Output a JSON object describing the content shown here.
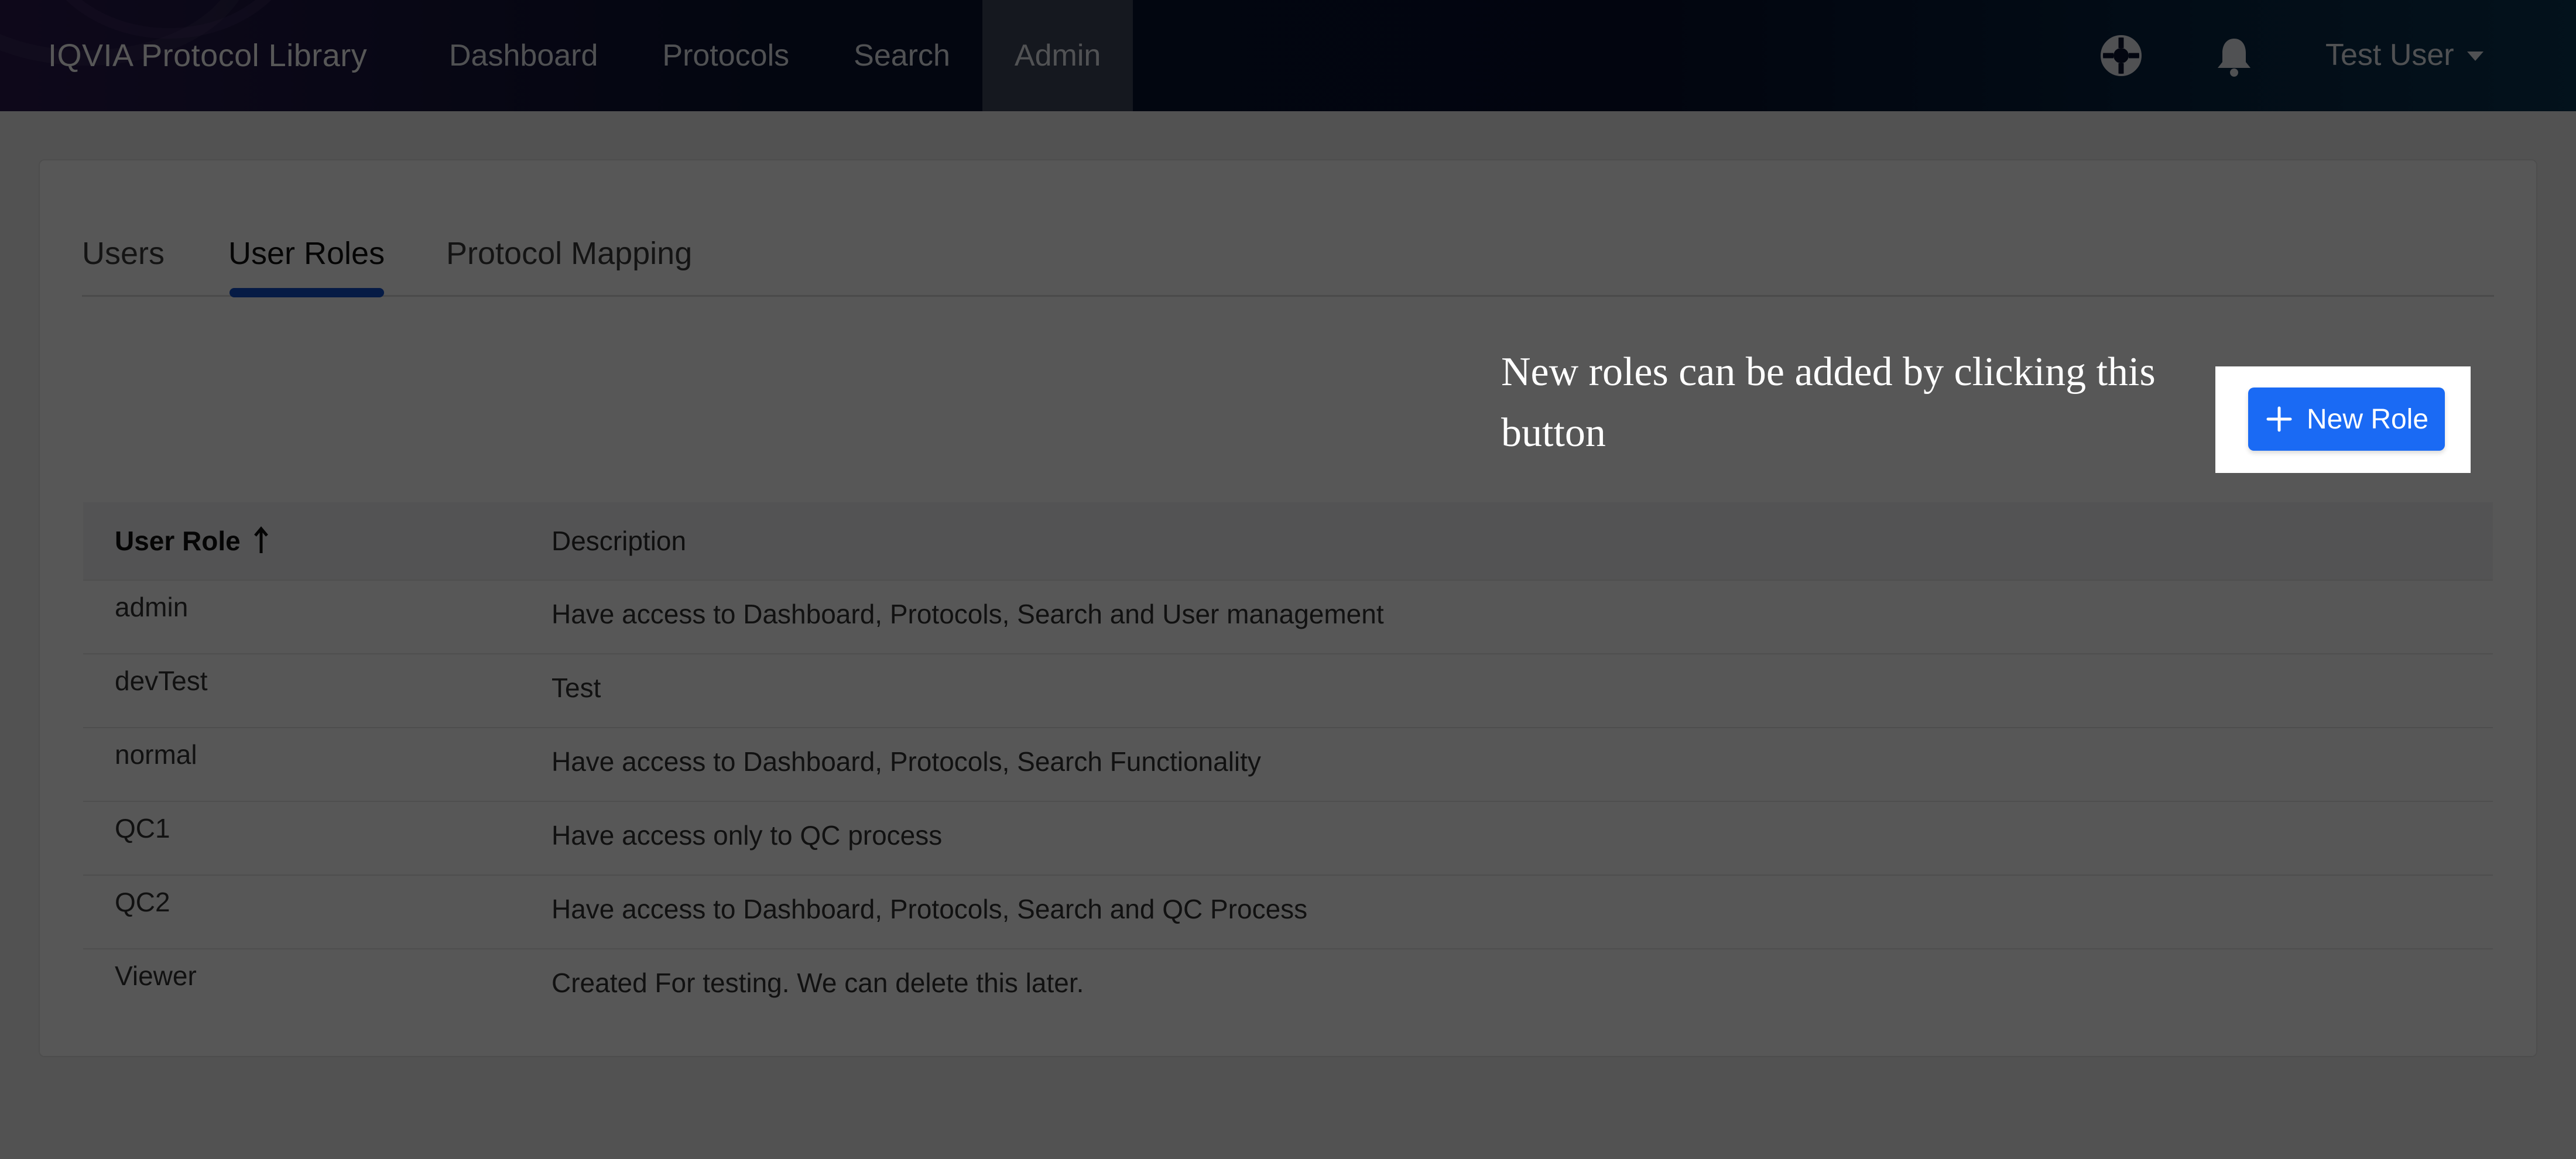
{
  "header": {
    "app_title": "IQVIA Protocol Library",
    "nav": [
      {
        "label": "Dashboard"
      },
      {
        "label": "Protocols"
      },
      {
        "label": "Search"
      },
      {
        "label": "Admin",
        "active": true
      }
    ],
    "icons": {
      "help": "lifebuoy-icon",
      "notifications": "bell-icon",
      "user_caret": "caret-down-icon"
    },
    "user_name": "Test User"
  },
  "tabs": [
    {
      "label": "Users"
    },
    {
      "label": "User Roles",
      "active": true
    },
    {
      "label": "Protocol Mapping"
    }
  ],
  "toolbar": {
    "new_role_label": "New Role",
    "new_role_icon": "plus-icon"
  },
  "tooltip": {
    "text": "New roles can be added by clicking this button"
  },
  "table": {
    "columns": [
      {
        "label": "User Role",
        "sort": "ascending",
        "sort_icon": "sort-arrow-up-icon"
      },
      {
        "label": "Description"
      }
    ],
    "rows": [
      {
        "role": "admin",
        "description": "Have access to Dashboard, Protocols, Search and User management"
      },
      {
        "role": "devTest",
        "description": "Test"
      },
      {
        "role": "normal",
        "description": "Have access to Dashboard, Protocols, Search Functionality"
      },
      {
        "role": "QC1",
        "description": "Have access only to QC process"
      },
      {
        "role": "QC2",
        "description": "Have access to Dashboard, Protocols, Search and QC Process"
      },
      {
        "role": "Viewer",
        "description": "Created For testing. We can delete this later."
      }
    ]
  },
  "colors": {
    "accent": "#1a6af4",
    "tab_underline": "#1251c9",
    "overlay": "rgba(0,0,0,0.66)"
  }
}
